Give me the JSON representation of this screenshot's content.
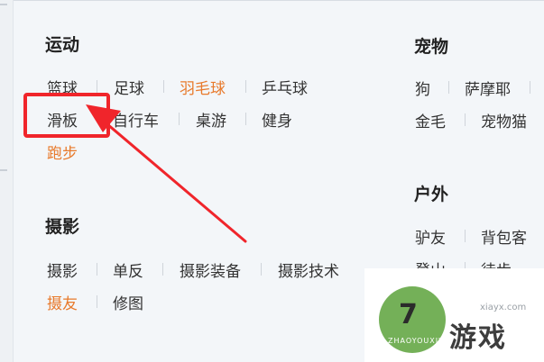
{
  "sections": {
    "sports": {
      "title": "运动",
      "tags": [
        "篮球",
        "足球",
        "羽毛球",
        "乒乓球",
        "滑板",
        "自行车",
        "桌游",
        "健身",
        "跑步"
      ]
    },
    "photo": {
      "title": "摄影",
      "tags": [
        "摄影",
        "单反",
        "摄影装备",
        "摄影技术",
        "摄友",
        "修图"
      ]
    },
    "pets": {
      "title": "宠物",
      "tags": [
        "狗",
        "萨摩耶",
        "金毛",
        "宠物猫"
      ]
    },
    "outdoor": {
      "title": "户外",
      "tags": [
        "驴友",
        "背包客",
        "登山",
        "徒步"
      ]
    }
  },
  "watermark": {
    "brand": "游戏",
    "domain": "xiayx.com",
    "pinyin": "ZHAOYOUXIWANG",
    "digit": "7"
  },
  "colors": {
    "hot_tag": "#e87a2c",
    "annotation": "#f0252b"
  }
}
